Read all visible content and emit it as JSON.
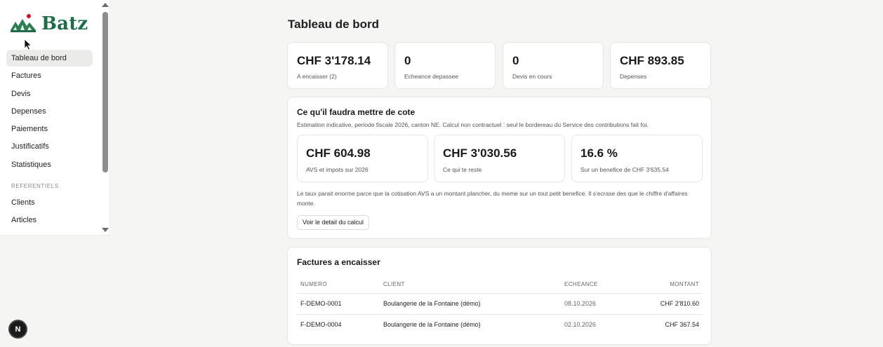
{
  "brand": {
    "name": "Batz"
  },
  "sidebar": {
    "items": [
      {
        "label": "Tableau de bord",
        "active": true
      },
      {
        "label": "Factures"
      },
      {
        "label": "Devis"
      },
      {
        "label": "Depenses"
      },
      {
        "label": "Paiements"
      },
      {
        "label": "Justificatifs"
      },
      {
        "label": "Statistiques"
      }
    ],
    "section_label": "REFERENTIELS",
    "section_items": [
      {
        "label": "Clients"
      },
      {
        "label": "Articles"
      }
    ]
  },
  "badge": {
    "label": "N"
  },
  "main": {
    "title": "Tableau de bord",
    "stats": [
      {
        "value": "CHF 3'178.14",
        "label": "A encaisser (2)"
      },
      {
        "value": "0",
        "label": "Echeance depassee"
      },
      {
        "value": "0",
        "label": "Devis en cours"
      },
      {
        "value": "CHF 893.85",
        "label": "Depenses"
      }
    ],
    "estimate": {
      "title": "Ce qu'il faudra mettre de cote",
      "subtitle": "Estimation indicative, periode fiscale 2026, canton NE. Calcul non contractuel : seul le bordereau du Service des contributions fait foi.",
      "cards": [
        {
          "value": "CHF 604.98",
          "label": "AVS et impots sur 2026"
        },
        {
          "value": "CHF 3'030.56",
          "label": "Ce qui te reste"
        },
        {
          "value": "16.6 %",
          "label": "Sur un benefice de CHF 3'635.54"
        }
      ],
      "note": "Le taux parait enorme parce que la cotisation AVS a un montant plancher, du meme sur un tout petit benefice. Il s'ecrase des que le chiffre d'affaires monte.",
      "button_label": "Voir le detail du calcul"
    },
    "invoices": {
      "title": "Factures a encaisser",
      "columns": [
        "NUMERO",
        "CLIENT",
        "ECHEANCE",
        "MONTANT"
      ],
      "rows": [
        {
          "numero": "F-DEMO-0001",
          "client": "Boulangerie de la Fontaine (démo)",
          "echeance": "08.10.2026",
          "montant": "CHF 2'810.60"
        },
        {
          "numero": "F-DEMO-0004",
          "client": "Boulangerie de la Fontaine (démo)",
          "echeance": "02.10.2026",
          "montant": "CHF 367.54"
        }
      ]
    }
  },
  "colors": {
    "brand_green": "#1f6b4a",
    "brand_red": "#c8102e",
    "active_bg": "#ececea"
  },
  "icons": [
    "logo-mountains-icon",
    "mouse-cursor-icon",
    "scroll-up-arrow-icon",
    "scroll-down-arrow-icon"
  ]
}
